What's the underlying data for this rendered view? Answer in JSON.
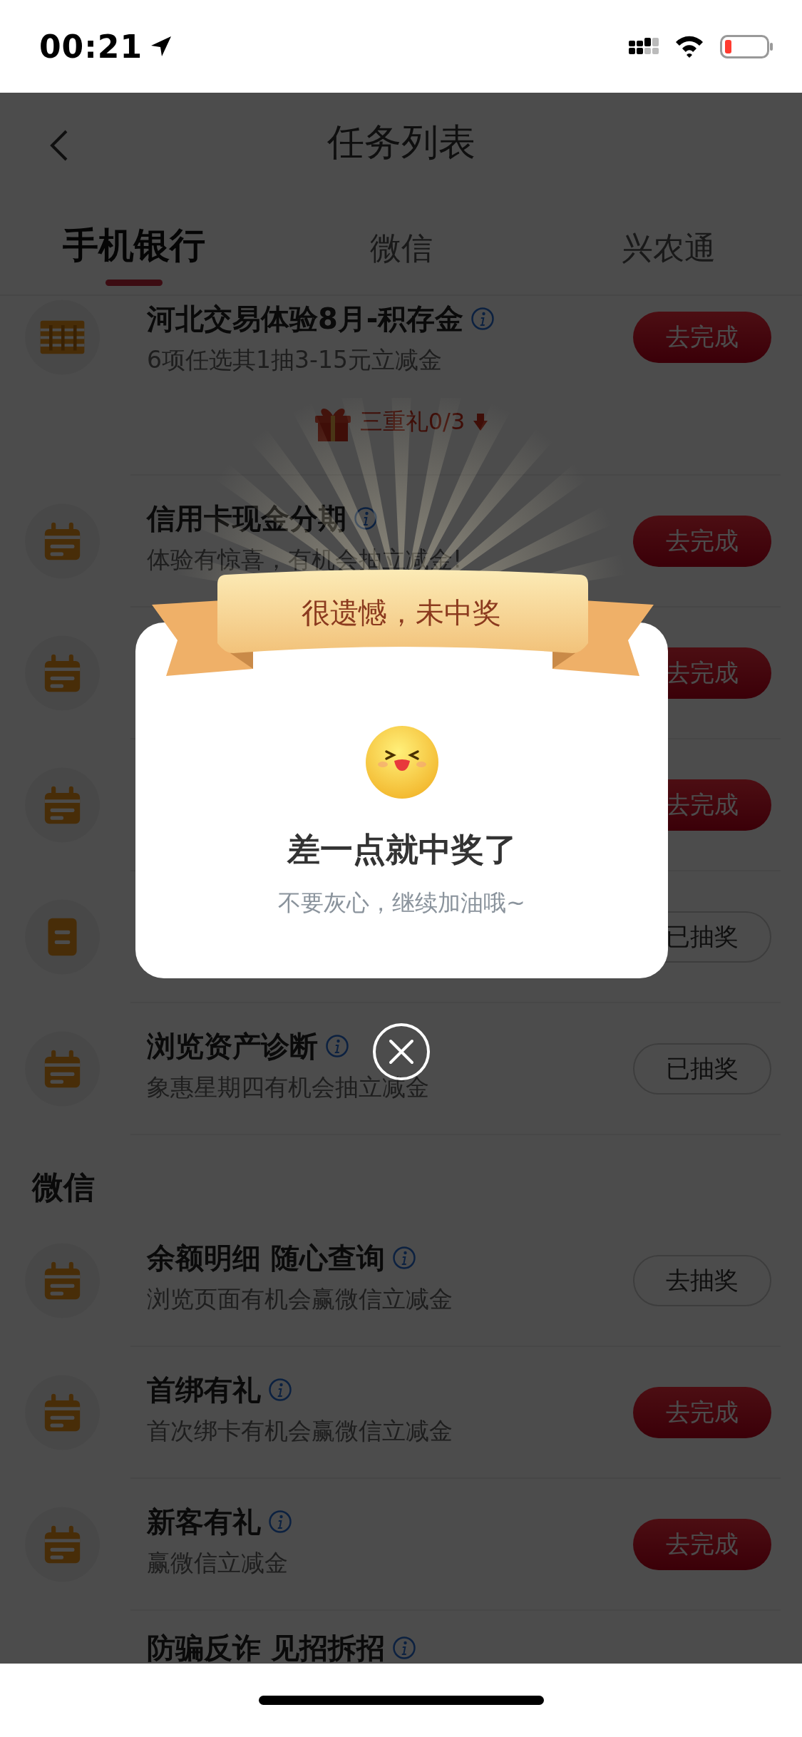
{
  "status_bar": {
    "time": "00:21"
  },
  "header": {
    "title": "任务列表"
  },
  "tabs": [
    {
      "label": "手机银行",
      "selected": true
    },
    {
      "label": "微信",
      "selected": false
    },
    {
      "label": "兴农通",
      "selected": false
    }
  ],
  "sections": [
    {
      "tasks": [
        {
          "kind": "abacus",
          "title": "河北交易体验8月-积存金",
          "info": true,
          "subtitle": "6项任选其1抽3-15元立减金",
          "button": {
            "label": "去完成",
            "kind": "primary"
          },
          "bundle": {
            "label": "三重礼0/3"
          }
        },
        {
          "kind": "calendar",
          "title": "信用卡现金分期",
          "info": true,
          "subtitle": "体验有惊喜，有机会抽立减金!",
          "button": {
            "label": "去完成",
            "kind": "primary"
          }
        },
        {
          "kind": "calendar",
          "button": {
            "label": "去完成",
            "kind": "primary"
          }
        },
        {
          "kind": "calendar",
          "button": {
            "label": "去完成",
            "kind": "primary"
          }
        },
        {
          "kind": "note",
          "button": {
            "label": "已抽奖",
            "kind": "outline"
          }
        },
        {
          "kind": "calendar",
          "title": "浏览资产诊断",
          "info": true,
          "subtitle": "象惠星期四有机会抽立减金",
          "button": {
            "label": "已抽奖",
            "kind": "outline"
          }
        }
      ]
    },
    {
      "heading": "微信",
      "tasks": [
        {
          "kind": "calendar",
          "title": "余额明细 随心查询",
          "info": true,
          "subtitle": "浏览页面有机会赢微信立减金",
          "button": {
            "label": "去抽奖",
            "kind": "outline"
          }
        },
        {
          "kind": "calendar",
          "title": "首绑有礼",
          "info": true,
          "subtitle": "首次绑卡有机会赢微信立减金",
          "button": {
            "label": "去完成",
            "kind": "primary"
          }
        },
        {
          "kind": "calendar",
          "title": "新客有礼",
          "info": true,
          "subtitle": "赢微信立减金",
          "button": {
            "label": "去完成",
            "kind": "primary"
          }
        },
        {
          "title": "防骗反诈 见招拆招",
          "info": true
        }
      ]
    }
  ],
  "popup": {
    "banner": "很遗憾，未中奖",
    "title": "差一点就中奖了",
    "message": "不要灰心，继续加油哦~"
  }
}
